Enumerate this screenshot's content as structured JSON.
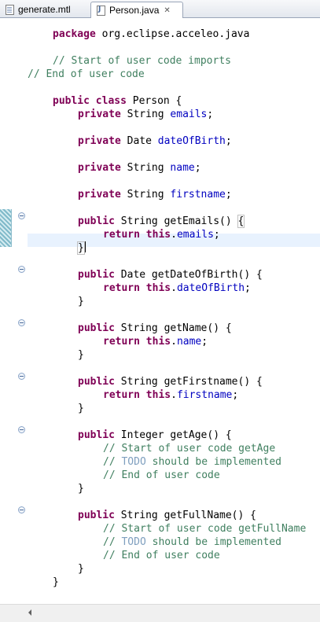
{
  "tabs": [
    {
      "label": "generate.mtl",
      "icon": "file-icon",
      "active": false
    },
    {
      "label": "Person.java",
      "icon": "java-file-icon",
      "active": true,
      "close_label": "✕"
    }
  ],
  "editor": {
    "colors": {
      "keyword": "#7f0055",
      "field": "#0000c0",
      "comment": "#3f7f5f",
      "todo": "#7f9fbf",
      "current_line": "#e8f2fe"
    },
    "lines": [
      {
        "tokens": [
          {
            "t": "package",
            "c": "kw"
          },
          {
            "t": " org.eclipse.acceleo.java"
          }
        ]
      },
      {
        "tokens": [
          {
            "t": "// Start of user code imports",
            "c": "cmt"
          }
        ]
      },
      {
        "tokens": [
          {
            "t": "// End of user code",
            "c": "cmt"
          }
        ]
      },
      {
        "tokens": [
          {
            "t": "public",
            "c": "kw"
          },
          {
            "t": " "
          },
          {
            "t": "class",
            "c": "kw"
          },
          {
            "t": " Person {"
          }
        ]
      },
      {
        "tokens": [
          {
            "t": "private",
            "c": "kw"
          },
          {
            "t": " String "
          },
          {
            "t": "emails",
            "c": "fld"
          },
          {
            "t": ";"
          }
        ]
      },
      {
        "tokens": [
          {
            "t": "private",
            "c": "kw"
          },
          {
            "t": " Date "
          },
          {
            "t": "dateOfBirth",
            "c": "fld"
          },
          {
            "t": ";"
          }
        ]
      },
      {
        "tokens": [
          {
            "t": "private",
            "c": "kw"
          },
          {
            "t": " String "
          },
          {
            "t": "name",
            "c": "fld"
          },
          {
            "t": ";"
          }
        ]
      },
      {
        "tokens": [
          {
            "t": "private",
            "c": "kw"
          },
          {
            "t": " String "
          },
          {
            "t": "firstname",
            "c": "fld"
          },
          {
            "t": ";"
          }
        ]
      },
      {
        "tokens": [
          {
            "t": "public",
            "c": "kw"
          },
          {
            "t": " String getEmails() "
          },
          {
            "t": "{",
            "c": "box"
          }
        ]
      },
      {
        "tokens": [
          {
            "t": "return",
            "c": "kw"
          },
          {
            "t": " "
          },
          {
            "t": "this",
            "c": "kw"
          },
          {
            "t": "."
          },
          {
            "t": "emails",
            "c": "fld"
          },
          {
            "t": ";"
          }
        ]
      },
      {
        "tokens": [
          {
            "t": "}",
            "c": "box"
          },
          {
            "t": "",
            "c": "caret"
          }
        ]
      },
      {
        "tokens": [
          {
            "t": "public",
            "c": "kw"
          },
          {
            "t": " Date getDateOfBirth() {"
          }
        ]
      },
      {
        "tokens": [
          {
            "t": "return",
            "c": "kw"
          },
          {
            "t": " "
          },
          {
            "t": "this",
            "c": "kw"
          },
          {
            "t": "."
          },
          {
            "t": "dateOfBirth",
            "c": "fld"
          },
          {
            "t": ";"
          }
        ]
      },
      {
        "tokens": [
          {
            "t": "}"
          }
        ]
      },
      {
        "tokens": [
          {
            "t": "public",
            "c": "kw"
          },
          {
            "t": " String getName() {"
          }
        ]
      },
      {
        "tokens": [
          {
            "t": "return",
            "c": "kw"
          },
          {
            "t": " "
          },
          {
            "t": "this",
            "c": "kw"
          },
          {
            "t": "."
          },
          {
            "t": "name",
            "c": "fld"
          },
          {
            "t": ";"
          }
        ]
      },
      {
        "tokens": [
          {
            "t": "}"
          }
        ]
      },
      {
        "tokens": [
          {
            "t": "public",
            "c": "kw"
          },
          {
            "t": " String getFirstname() {"
          }
        ]
      },
      {
        "tokens": [
          {
            "t": "return",
            "c": "kw"
          },
          {
            "t": " "
          },
          {
            "t": "this",
            "c": "kw"
          },
          {
            "t": "."
          },
          {
            "t": "firstname",
            "c": "fld"
          },
          {
            "t": ";"
          }
        ]
      },
      {
        "tokens": [
          {
            "t": "}"
          }
        ]
      },
      {
        "tokens": [
          {
            "t": "public",
            "c": "kw"
          },
          {
            "t": " Integer getAge() {"
          }
        ]
      },
      {
        "tokens": [
          {
            "t": "// Start of user code getAge",
            "c": "cmt"
          }
        ]
      },
      {
        "tokens": [
          {
            "t": "// ",
            "c": "cmt"
          },
          {
            "t": "TODO",
            "c": "todo"
          },
          {
            "t": " should be implemented",
            "c": "cmt"
          }
        ]
      },
      {
        "tokens": [
          {
            "t": "// End of user code",
            "c": "cmt"
          }
        ]
      },
      {
        "tokens": [
          {
            "t": "}"
          }
        ]
      },
      {
        "tokens": [
          {
            "t": "public",
            "c": "kw"
          },
          {
            "t": " String getFullName() {"
          }
        ]
      },
      {
        "tokens": [
          {
            "t": "// Start of user code getFullName",
            "c": "cmt"
          }
        ]
      },
      {
        "tokens": [
          {
            "t": "// ",
            "c": "cmt"
          },
          {
            "t": "TODO",
            "c": "todo"
          },
          {
            "t": " should be implemented",
            "c": "cmt"
          }
        ]
      },
      {
        "tokens": [
          {
            "t": "// End of user code",
            "c": "cmt"
          }
        ]
      },
      {
        "tokens": [
          {
            "t": "}"
          }
        ]
      },
      {
        "tokens": [
          {
            "t": "}"
          }
        ]
      }
    ],
    "fold_markers": [
      "collapse-icon",
      "collapse-icon",
      "collapse-icon",
      "collapse-icon",
      "collapse-icon",
      "collapse-icon"
    ]
  },
  "scrollbar": {
    "left_arrow_icon": "scroll-left-arrow-icon"
  }
}
